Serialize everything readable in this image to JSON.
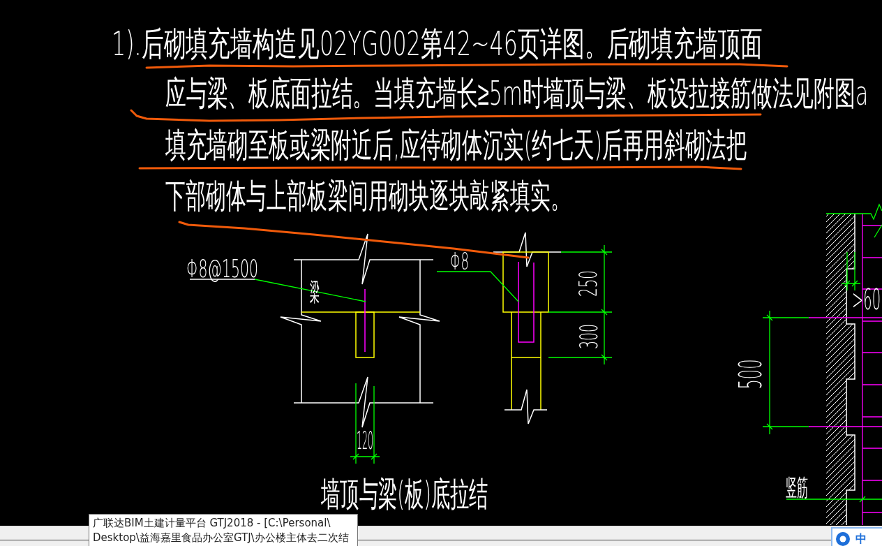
{
  "notes": [
    "1).后砌填充墙构造见02YG002第42~46页详图。后砌填充墙顶面",
    "应与梁、板底面拉结。当填充墙长≥5m时墙顶与梁、板设拉接筋做法见附图a",
    "填充墙砌至板或梁附近后,应待砌体沉实(约七天)后再用斜砌法把",
    "下部砌体与上部板梁间用砌块逐块敲紧填实。"
  ],
  "details": [
    {
      "labels": [
        "Φ8@1500",
        "梁",
        "120"
      ]
    },
    {
      "labels": [
        "Φ8",
        "250",
        "300"
      ]
    },
    {
      "labels": [
        "500",
        ">60",
        "竖筋"
      ]
    }
  ],
  "figure_title": "墙顶与梁(板)底拉结",
  "tooltip": {
    "lines": [
      "广联达BIM土建计量平台 GTJ2018 - [C:\\Personal\\",
      "Desktop\\益海嘉里食品办公室GTJ\\办公楼主体去二次结"
    ]
  },
  "ime_toolbar": {
    "mode_label": "中"
  }
}
